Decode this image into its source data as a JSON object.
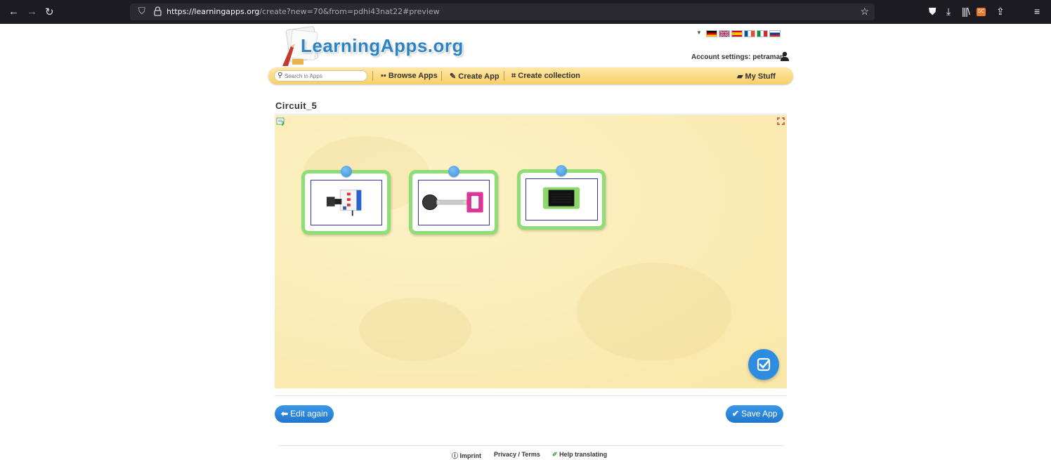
{
  "browser": {
    "url_domain": "https://learningapps.org",
    "url_path": "/create?new=70&from=pdhi43nat22#preview"
  },
  "site": {
    "logo_text": "LearningApps.org",
    "account_label": "Account settings: petraman",
    "languages": [
      "de",
      "en",
      "es",
      "fr",
      "it",
      "ru"
    ]
  },
  "menubar": {
    "search_placeholder": "Search in Apps",
    "browse_label": "Browse Apps",
    "create_label": "Create App",
    "collection_label": "Create collection",
    "mystuff_label": "My Stuff"
  },
  "app": {
    "title": "Circuit_5",
    "cards": [
      {
        "content": "circuit-board-module"
      },
      {
        "content": "pressure-sensor-module"
      },
      {
        "content": "display-module"
      }
    ]
  },
  "actions": {
    "edit_label": "Edit again",
    "save_label": "Save App"
  },
  "footer": {
    "imprint": "Imprint",
    "privacy": "Privacy / Terms",
    "translate": "Help translating"
  },
  "colors": {
    "accent_blue": "#2d8ee0",
    "card_border": "#8fde75",
    "menubar": "#f8cf66"
  }
}
